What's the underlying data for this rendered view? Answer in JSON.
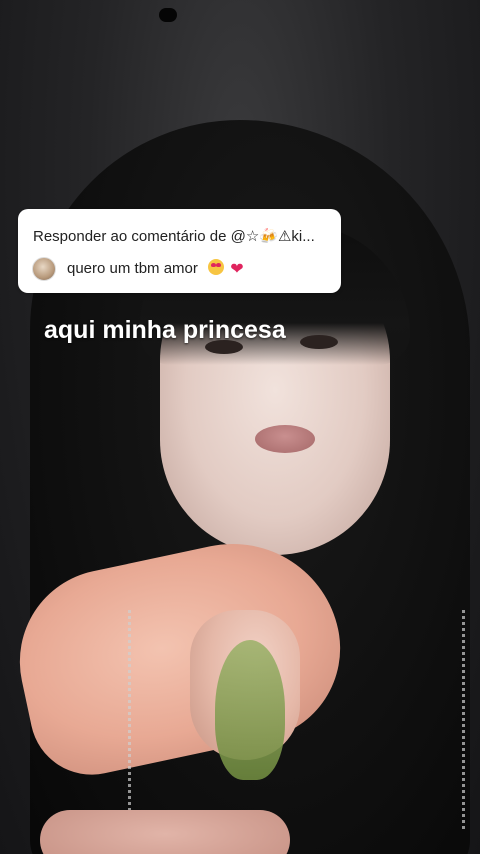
{
  "reply": {
    "header": "Responder ao comentário de @☆🍻⚠ki...",
    "comment": "quero um tbm amor",
    "emoji_1": "heart-eyes",
    "emoji_2": "❤"
  },
  "caption": "aqui minha princesa",
  "colors": {
    "card_bg": "#ffffff",
    "caption_text": "#ffffff",
    "heart": "#e0245e"
  }
}
